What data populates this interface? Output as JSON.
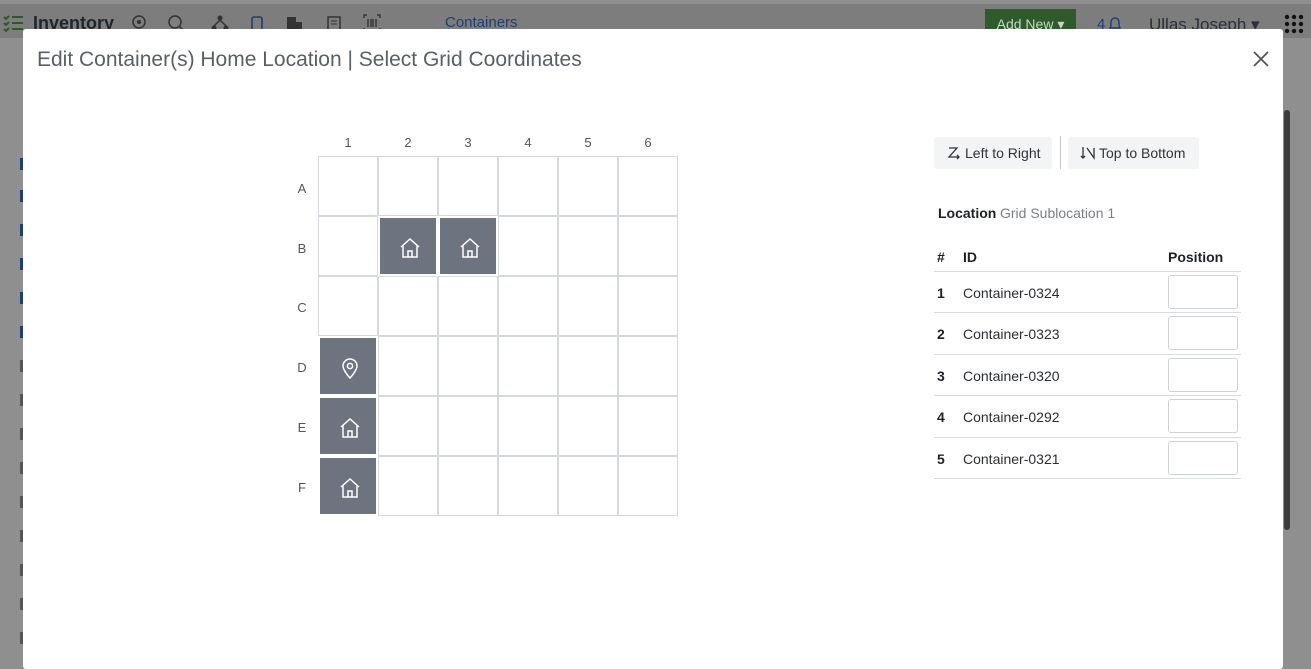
{
  "background_app": {
    "app_title": "Inventory",
    "nav_link": "Containers",
    "add_new_label": "Add New ▾",
    "notification_count": "4",
    "user_name": "Ullas Joseph ▾"
  },
  "modal": {
    "title": "Edit Container(s) Home Location | Select Grid Coordinates"
  },
  "grid": {
    "columns": [
      "1",
      "2",
      "3",
      "4",
      "5",
      "6"
    ],
    "rows": [
      "A",
      "B",
      "C",
      "D",
      "E",
      "F"
    ],
    "filled_cells": [
      {
        "row": "B",
        "col": "2",
        "icon": "home-icon"
      },
      {
        "row": "B",
        "col": "3",
        "icon": "home-icon"
      },
      {
        "row": "D",
        "col": "1",
        "icon": "location-pin-icon"
      },
      {
        "row": "E",
        "col": "1",
        "icon": "home-icon"
      },
      {
        "row": "F",
        "col": "1",
        "icon": "home-icon"
      }
    ],
    "filled_color": "#6d7480"
  },
  "fill_order": {
    "left_to_right_label": "Left to Right",
    "top_to_bottom_label": "Top to Bottom"
  },
  "location": {
    "label": "Location",
    "value": "Grid Sublocation 1"
  },
  "table": {
    "headers": {
      "num": "#",
      "id": "ID",
      "position": "Position"
    },
    "rows": [
      {
        "num": "1",
        "id": "Container-0324",
        "position": ""
      },
      {
        "num": "2",
        "id": "Container-0323",
        "position": ""
      },
      {
        "num": "3",
        "id": "Container-0320",
        "position": ""
      },
      {
        "num": "4",
        "id": "Container-0292",
        "position": ""
      },
      {
        "num": "5",
        "id": "Container-0321",
        "position": ""
      }
    ]
  }
}
